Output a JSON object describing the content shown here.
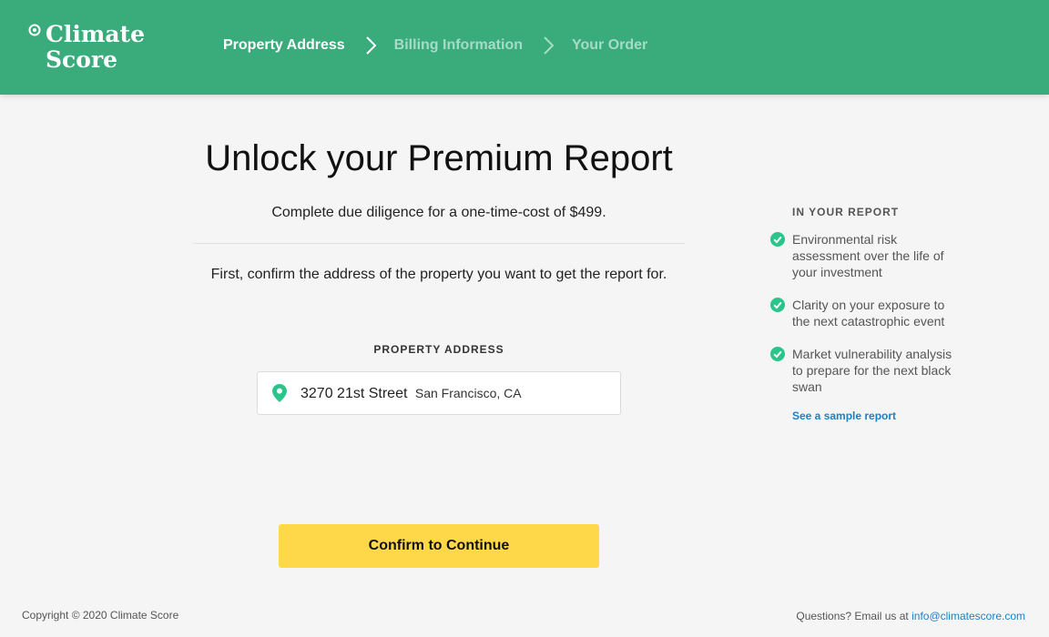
{
  "brand": {
    "name_line1": "Climate",
    "name_line2": "Score",
    "primary_color": "#3aab7b",
    "accent_color": "#ffd84a"
  },
  "steps": [
    {
      "label": "Property Address",
      "state": "active"
    },
    {
      "label": "Billing Information",
      "state": "inactive"
    },
    {
      "label": "Your Order",
      "state": "inactive"
    }
  ],
  "main": {
    "title": "Unlock your Premium Report",
    "subtitle": "Complete due diligence for a one-time-cost of $499.",
    "instruction": "First, confirm the address of the property you want to get the report for.",
    "field_label": "PROPERTY ADDRESS",
    "address_street": "3270 21st Street",
    "address_city": "San Francisco, CA",
    "confirm_label": "Confirm to Continue"
  },
  "sidebar": {
    "heading": "IN YOUR REPORT",
    "benefits": [
      "Environmental risk assessment over the life of your investment",
      "Clarity on your exposure to the next catastrophic event",
      "Market vulnerability analysis to prepare for the next black swan"
    ],
    "sample_link": "See a sample report"
  },
  "footer": {
    "copyright": "Copyright © 2020 Climate Score",
    "contact_prefix": "Questions? Email us at",
    "contact_email": "info@climatescore.com"
  },
  "icons": {
    "logo": "climate-score-logo-icon",
    "chevron": "chevron-right-icon",
    "pin": "location-pin-icon",
    "check": "check-circle-icon"
  }
}
